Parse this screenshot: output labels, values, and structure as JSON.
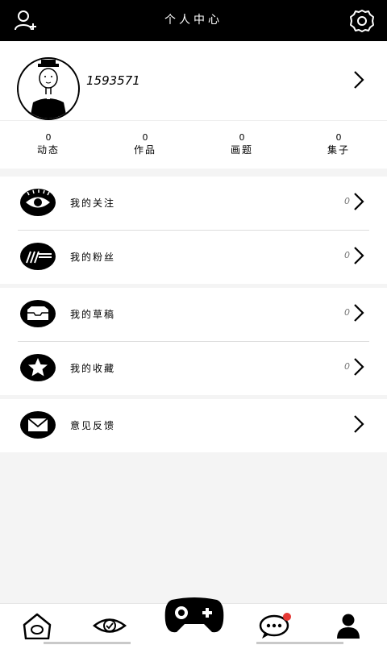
{
  "header": {
    "title": "个人中心",
    "add_friend_icon": "person-add-icon",
    "settings_icon": "gear-icon"
  },
  "profile": {
    "username": "1593571",
    "avatar_icon": "avatar-man-with-hat"
  },
  "stats": [
    {
      "value": "0",
      "label": "动态"
    },
    {
      "value": "0",
      "label": "作品"
    },
    {
      "value": "0",
      "label": "画题"
    },
    {
      "value": "0",
      "label": "集子"
    }
  ],
  "menu": {
    "follow": {
      "label": "我的关注",
      "count": "0",
      "icon": "eye-icon"
    },
    "fans": {
      "label": "我的粉丝",
      "count": "0",
      "icon": "fans-icon"
    },
    "drafts": {
      "label": "我的草稿",
      "count": "0",
      "icon": "inbox-tray-icon"
    },
    "favorites": {
      "label": "我的收藏",
      "count": "0",
      "icon": "star-icon"
    },
    "feedback": {
      "label": "意见反馈",
      "icon": "envelope-icon"
    }
  },
  "tabbar": {
    "home_icon": "home-icon",
    "discover_icon": "eye-icon",
    "game_icon": "gamepad-icon",
    "messages_icon": "chat-bubble-icon",
    "profile_icon": "person-icon",
    "colors": {
      "notification_dot": "#e53935"
    }
  }
}
